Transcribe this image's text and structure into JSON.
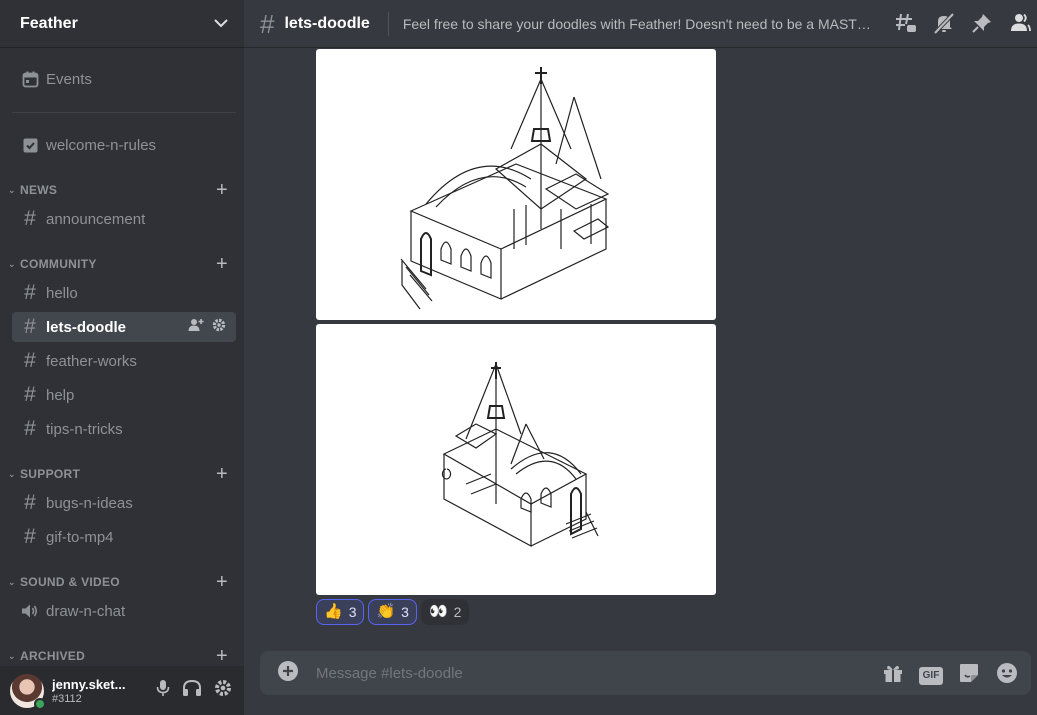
{
  "server": {
    "name": "Feather"
  },
  "sidebar": {
    "events_label": "Events",
    "welcome_label": "welcome-n-rules",
    "categories": {
      "news": "NEWS",
      "community": "COMMUNITY",
      "support": "SUPPORT",
      "sound_video": "SOUND & VIDEO",
      "archived": "ARCHIVED"
    },
    "channels": {
      "announcement": "announcement",
      "hello": "hello",
      "lets_doodle": "lets-doodle",
      "feather_works": "feather-works",
      "help": "help",
      "tips_n_tricks": "tips-n-tricks",
      "bugs_n_ideas": "bugs-n-ideas",
      "gif_to_mp4": "gif-to-mp4",
      "draw_n_chat": "draw-n-chat"
    }
  },
  "user": {
    "name": "jenny.sket...",
    "tag": "#3112",
    "status_color": "#3ba55d"
  },
  "header": {
    "channel_title": "lets-doodle",
    "topic": "Feel free to share your doodles with Feather! Doesn't need to be a MASTERPIE..."
  },
  "reactions": [
    {
      "emoji": "👍",
      "count": "3",
      "icon": "thumbs-up-icon"
    },
    {
      "emoji": "👏",
      "count": "3",
      "icon": "clapping-hands-icon"
    },
    {
      "emoji": "👀",
      "count": "2",
      "icon": "eyes-icon"
    }
  ],
  "composer": {
    "placeholder": "Message #lets-doodle",
    "gif_label": "GIF"
  },
  "colors": {
    "accent": "#5865f2",
    "sidebar_bg": "#2f3136",
    "chat_bg": "#36393f"
  }
}
